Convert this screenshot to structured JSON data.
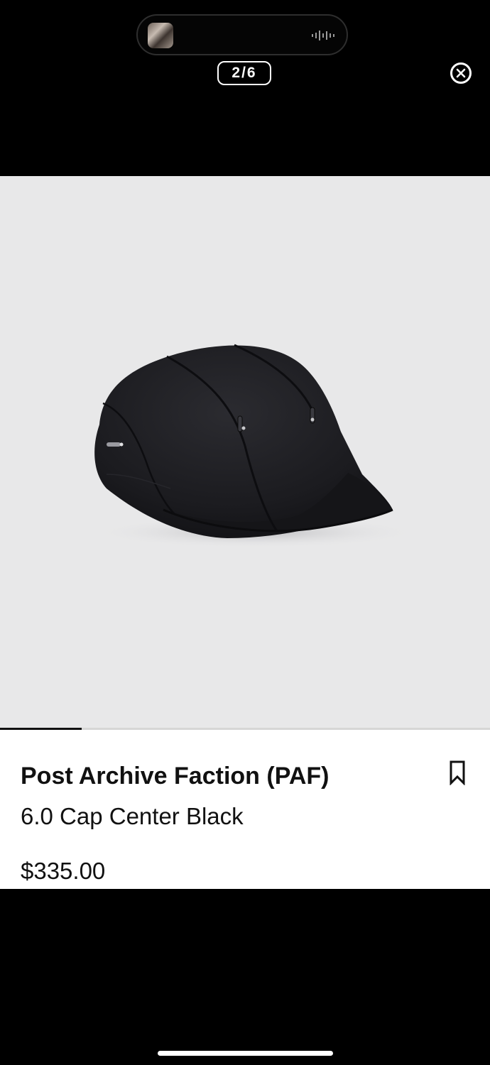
{
  "viewer": {
    "counter": "2/6"
  },
  "product": {
    "brand": "Post Archive Faction (PAF)",
    "name": "6.0 Cap Center Black",
    "price": "$335.00",
    "image_progress": 0.1667
  },
  "icons": {
    "close": "close-circle-icon",
    "bookmark": "bookmark-icon",
    "waveform": "audio-waveform-icon"
  },
  "colors": {
    "image_background": "#e8e8e9",
    "cap": "#1b1b1f",
    "text": "#111111"
  }
}
